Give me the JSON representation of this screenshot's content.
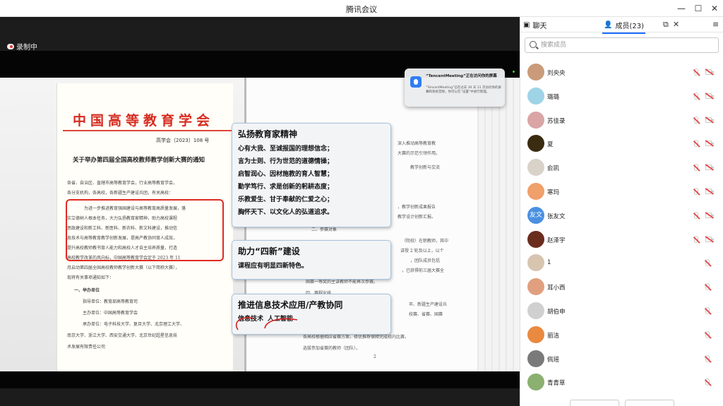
{
  "window": {
    "title": "腾讯会议",
    "minimize": "—",
    "maximize": "☐",
    "close": "✕"
  },
  "recording": {
    "label": "录制中"
  },
  "document_left": {
    "org_name": "中国高等教育学会",
    "doc_number": "高学会〔2023〕108 号",
    "title": "关于举办第四届全国高校教师教学创新大赛的通知",
    "lines": [
      "各省、自治区、直辖市高等教育学会，行业高等教育学会，",
      "各分支机构，各高校，各新疆生产建设兵团，有关高校：",
      "为进一步推进教育强国建设与高等教育高质量发展，落",
      "实立德树人根本任务，大力弘扬教育家精神，助力高校课程",
      "思政建设和新工科、新医科、新农科、新文科建设，推动信",
      "息技术与高等教育教学创新发展，提高产教协同育人成效，",
      "提升高校教师教书育人能力和高校人才自主培养质量，打造",
      "高校教学改革的风向标，中国高等教育学会定于 2023 年 11",
      "月启动第四届全国高校教师教学创新大赛（以下简称大赛），",
      "现将有关事项通知如下：",
      "一、举办单位",
      "指导单位：教育部高等教育司",
      "主办单位：中国高等教育学会",
      "承办单位：电子科技大学、复旦大学、北京理工大学、",
      "南京大学、浙江大学、西安交通大学、北京世纪超星信息技",
      "术发展有限责任公司"
    ]
  },
  "document_right": {
    "lines": [
      "深入推动高等教育教",
      "大赛的示范引领作用。",
      "教学创新与交流",
      "，教学创新成果报告",
      "教学设计创新汇报。",
      "二、参赛对象",
      "（院校）在职教师，其中",
      "讲授 2 轮及以上，以个",
      "，团队成员包括",
      "，已获得前三届大赛全",
      "国赛一等奖的主讲教师不能再次参赛。",
      "四、赛程安排",
      "市、新疆生产建设兵",
      "校赛、省赛、国赛",
      "（一）校赛",
      "各高校根据相应省赛方案，择优推荐保障完成校内比赛，",
      "选拔参加省赛的教师（团队）。",
      "2"
    ]
  },
  "callouts": [
    {
      "heading": "弘扬教育家精神",
      "lines": [
        "心有大我、至诚报国的理想信念；",
        "言为士则、行为世范的道德情操；",
        "启智润心、因材施教的育人智慧；",
        "勤学笃行、求是创新的躬耕态度；",
        "乐教爱生、甘于奉献的仁爱之心；",
        "胸怀天下、以文化人的弘道追求。"
      ]
    },
    {
      "heading": "助力“四新”建设",
      "lines": [
        "课程应有明显四新特色。"
      ]
    },
    {
      "heading": "推进信息技术应用/产教协同",
      "tags": [
        "信息技术",
        "人工智能"
      ]
    }
  ],
  "notification": {
    "title": "“TencentMeeting”正在访问你的屏幕",
    "body": "“TencentMeeting”已在过去 30 天 11 次访问你的屏幕和系统音频，你可以在“设置”中进行管理。"
  },
  "panel": {
    "tab_chat": "聊天",
    "tab_members": "成员(23)",
    "search_placeholder": "搜索成员",
    "members": [
      {
        "name": "刘央央",
        "avatar_color": "#c99b7a",
        "avatar_text": "",
        "cam": true
      },
      {
        "name": "璐璐",
        "avatar_color": "#9fd3e6",
        "avatar_text": "",
        "cam": true
      },
      {
        "name": "苏佳录",
        "avatar_color": "#d9a5a5",
        "avatar_text": "",
        "cam": true
      },
      {
        "name": "夏",
        "avatar_color": "#3a2c10",
        "avatar_text": "",
        "cam": true
      },
      {
        "name": "俞凯",
        "avatar_color": "#d8d2c8",
        "avatar_text": "",
        "cam": true
      },
      {
        "name": "寒玛",
        "avatar_color": "#f0a06a",
        "avatar_text": "",
        "cam": true
      },
      {
        "name": "张友文",
        "avatar_color": "#4a90e2",
        "avatar_text": "友文",
        "cam": true
      },
      {
        "name": "赵泽宇",
        "avatar_color": "#6a2d1e",
        "avatar_text": "",
        "cam": true
      },
      {
        "name": "1",
        "avatar_color": "#d7c5b0",
        "avatar_text": "",
        "cam": false
      },
      {
        "name": "耳小西",
        "avatar_color": "#e0a080",
        "avatar_text": "",
        "cam": false
      },
      {
        "name": "胡伯申",
        "avatar_color": "#d0d0d0",
        "avatar_text": "",
        "cam": false
      },
      {
        "name": "丽洁",
        "avatar_color": "#e98a40",
        "avatar_text": "",
        "cam": false
      },
      {
        "name": "佩瑶",
        "avatar_color": "#7a7a7a",
        "avatar_text": "",
        "cam": false
      },
      {
        "name": "青青草",
        "avatar_color": "#8bb070",
        "avatar_text": "",
        "cam": false
      }
    ]
  }
}
